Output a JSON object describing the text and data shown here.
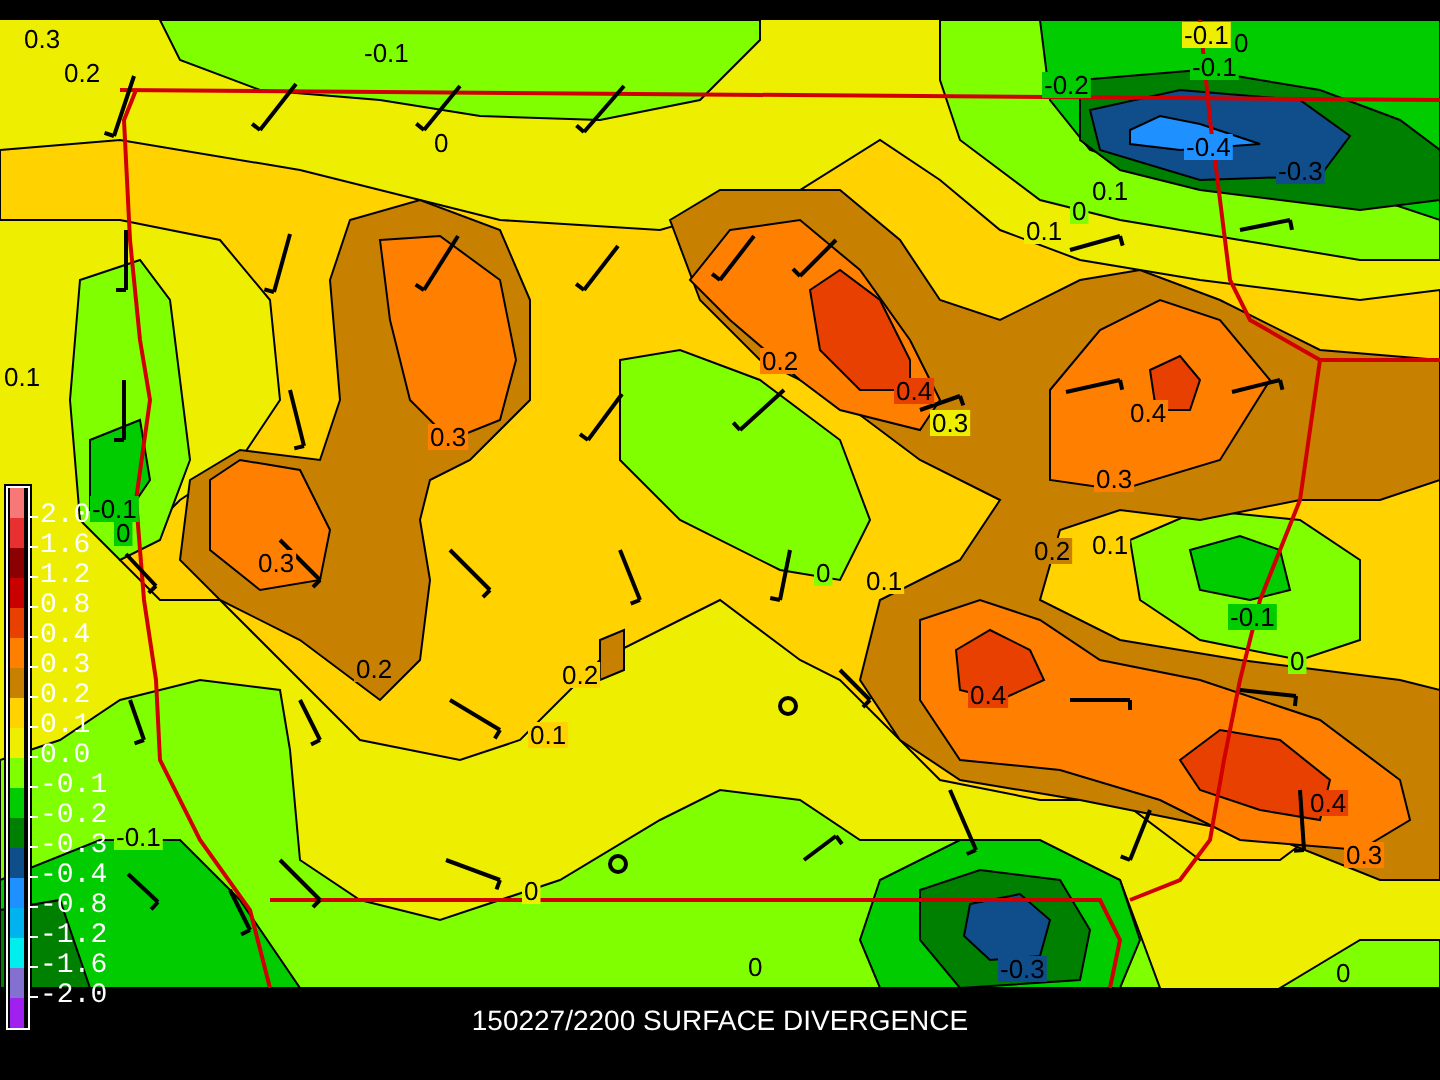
{
  "map": {
    "contour_labels": [
      "0.3",
      "0.2",
      "-0.1",
      "0",
      "-0.1",
      "0",
      "-0.1",
      "-0.2",
      "-0.4",
      "-0.3",
      "0.1",
      "0",
      "0.1",
      "0.1",
      "0.2",
      "0.4",
      "0.3",
      "0.4",
      "0.3",
      "0.3",
      "-0.1",
      "0",
      "0.3",
      "0.2",
      "0.2",
      "0.1",
      "0",
      "0.1",
      "0.2",
      "0.1",
      "-0.1",
      "0",
      "0.4",
      "0.4",
      "0.3",
      "-0.1",
      "0",
      "0",
      "-0.3",
      "0"
    ]
  },
  "legend": {
    "swatches": [
      {
        "color": "#f87878"
      },
      {
        "color": "#e83030"
      },
      {
        "color": "#8b0000"
      },
      {
        "color": "#c80000"
      },
      {
        "color": "#e84000"
      },
      {
        "color": "#ff8000"
      },
      {
        "color": "#c88000"
      },
      {
        "color": "#ffd200"
      },
      {
        "color": "#eeee00"
      },
      {
        "color": "#80ff00"
      },
      {
        "color": "#00cc00"
      },
      {
        "color": "#008000"
      },
      {
        "color": "#104e8b"
      },
      {
        "color": "#1e90ff"
      },
      {
        "color": "#00b2ee"
      },
      {
        "color": "#00eeee"
      },
      {
        "color": "#8470d0"
      },
      {
        "color": "#a020f0"
      }
    ],
    "labels": [
      "2.0",
      "1.6",
      "1.2",
      "0.8",
      "0.4",
      "0.3",
      "0.2",
      "0.1",
      "0.0",
      "-0.1",
      "-0.2",
      "-0.3",
      "-0.4",
      "-0.8",
      "-1.2",
      "-1.6",
      "-2.0"
    ]
  },
  "title": "150227/2200 SURFACE DIVERGENCE"
}
